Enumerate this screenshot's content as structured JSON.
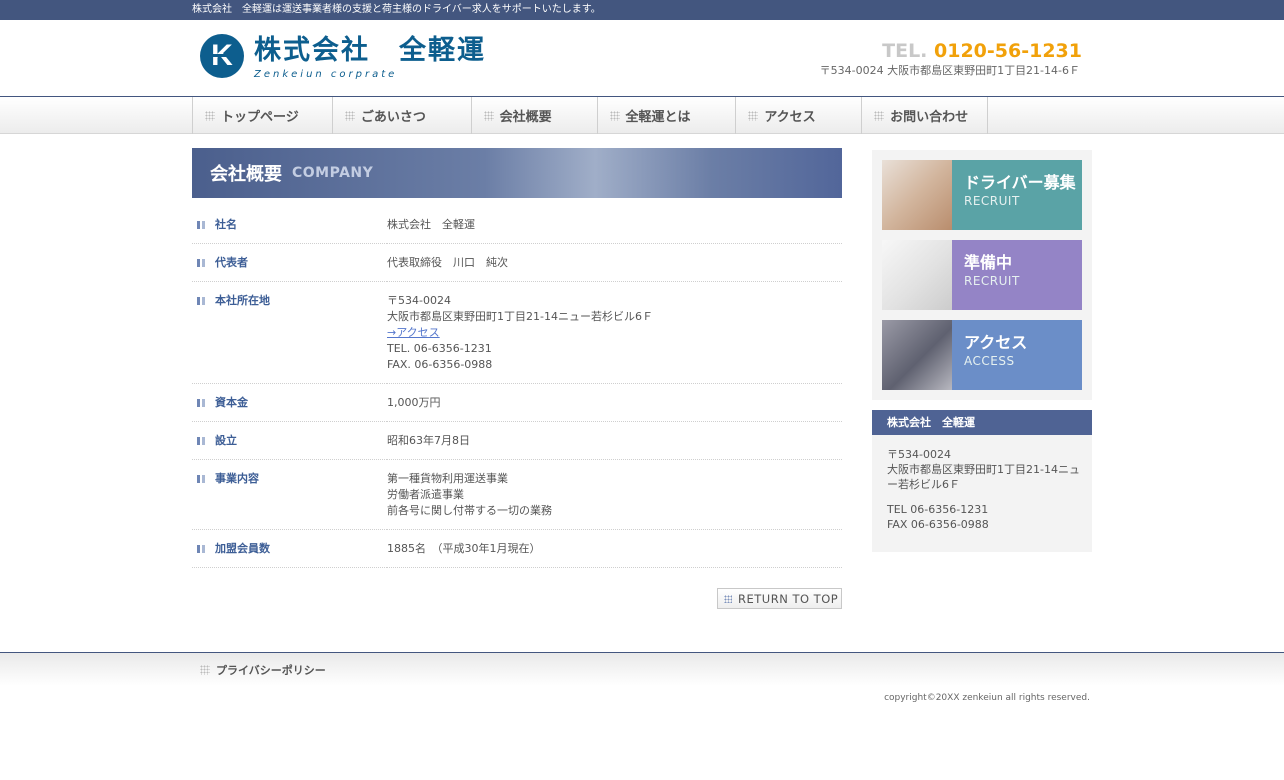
{
  "topbar": {
    "text": "株式会社　全軽運は運送事業者様の支援と荷主様のドライバー求人をサポートいたします。"
  },
  "header": {
    "logo_mark": "K",
    "logo_name": "株式会社　全軽運",
    "logo_sub": "Zenkeiun corprate",
    "tel_label": "TEL.",
    "tel_number": "0120-56-1231",
    "address": "〒534-0024 大阪市都島区東野田町1丁目21-14-6Ｆ"
  },
  "nav": [
    {
      "label": "トップページ"
    },
    {
      "label": "ごあいさつ"
    },
    {
      "label": "会社概要"
    },
    {
      "label": "全軽運とは"
    },
    {
      "label": "アクセス"
    },
    {
      "label": "お問い合わせ"
    }
  ],
  "page": {
    "title": "会社概要",
    "title_en": "COMPANY"
  },
  "rows": [
    {
      "label": "社名",
      "lines": [
        "株式会社　全軽運"
      ]
    },
    {
      "label": "代表者",
      "lines": [
        "代表取締役　川口　純次"
      ]
    },
    {
      "label": "本社所在地",
      "lines": [
        "〒534-0024",
        "大阪市都島区東野田町1丁目21-14ニュー若杉ビル6Ｆ"
      ],
      "link": "→アクセス",
      "lines2": [
        "TEL. 06-6356-1231",
        "FAX. 06-6356-0988"
      ]
    },
    {
      "label": "資本金",
      "lines": [
        "1,000万円"
      ]
    },
    {
      "label": "設立",
      "lines": [
        "昭和63年7月8日"
      ]
    },
    {
      "label": "事業内容",
      "lines": [
        "第一種貨物利用運送事業",
        "労働者派遣事業",
        "前各号に関し付帯する一切の業務"
      ]
    },
    {
      "label": "加盟会員数",
      "lines": [
        "1885名　（平成30年1月現在）"
      ]
    }
  ],
  "return_to_top": "RETURN TO TOP",
  "sidebar": {
    "banners": [
      {
        "title": "ドライバー募集",
        "sub": "RECRUIT"
      },
      {
        "title": "準備中",
        "sub": "RECRUIT"
      },
      {
        "title": "アクセス",
        "sub": "ACCESS"
      }
    ],
    "company": {
      "name": "株式会社　全軽運",
      "zip": "〒534-0024",
      "address": "大阪市都島区東野田町1丁目21-14ニュー若杉ビル6Ｆ",
      "tel": "TEL 06-6356-1231",
      "fax": "FAX 06-6356-0988"
    }
  },
  "footer": {
    "privacy": "プライバシーポリシー",
    "copyright": "copyright©20XX zenkeiun all rights reserved."
  }
}
